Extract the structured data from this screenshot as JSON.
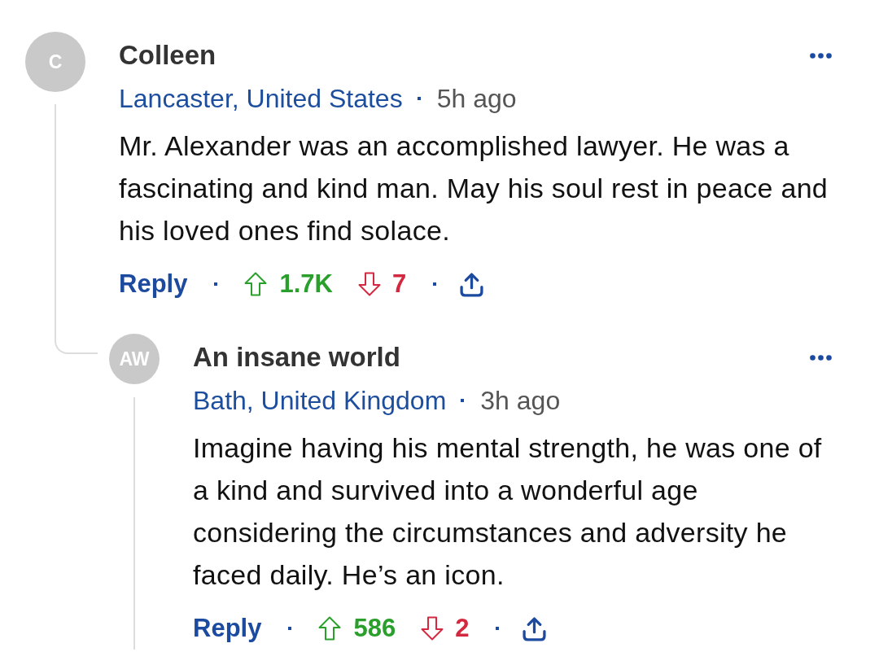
{
  "comments": [
    {
      "avatar_initials": "C",
      "author": "Colleen",
      "location": "Lancaster, United States",
      "time": "5h ago",
      "body": "Mr. Alexander was an accomplished lawyer. He was a fascinating and kind man. May his soul rest in peace and his loved ones find solace.",
      "reply_label": "Reply",
      "upvotes": "1.7K",
      "downvotes": "7",
      "replies": [
        {
          "avatar_initials": "AW",
          "author": "An insane world",
          "location": "Bath, United Kingdom",
          "time": "3h ago",
          "body": "Imagine having his mental strength, he was one of a kind and survived into a wonderful age considering the circumstances and adversity he faced daily. He’s an icon.",
          "reply_label": "Reply",
          "upvotes": "586",
          "downvotes": "2"
        }
      ]
    }
  ]
}
